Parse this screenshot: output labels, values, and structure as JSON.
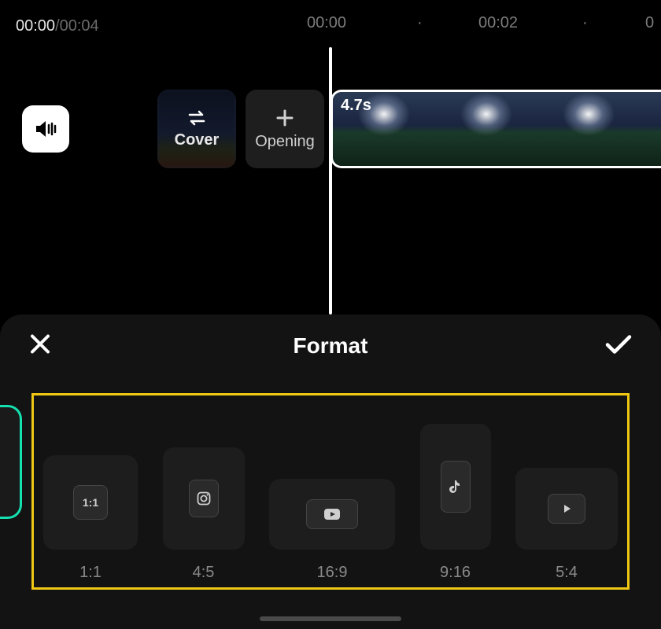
{
  "time": {
    "current": "00:00",
    "total": "00:04"
  },
  "ruler": {
    "t0": "00:00",
    "t2": "00:02",
    "t4_partial": "0"
  },
  "track": {
    "cover_label": "Cover",
    "opening_label": "Opening",
    "clip_duration": "4.7s"
  },
  "format": {
    "title": "Format",
    "options": [
      {
        "label": "1:1",
        "icon": "aspect-1-1"
      },
      {
        "label": "4:5",
        "icon": "instagram"
      },
      {
        "label": "16:9",
        "icon": "youtube"
      },
      {
        "label": "9:16",
        "icon": "tiktok"
      },
      {
        "label": "5:4",
        "icon": "play"
      }
    ]
  }
}
